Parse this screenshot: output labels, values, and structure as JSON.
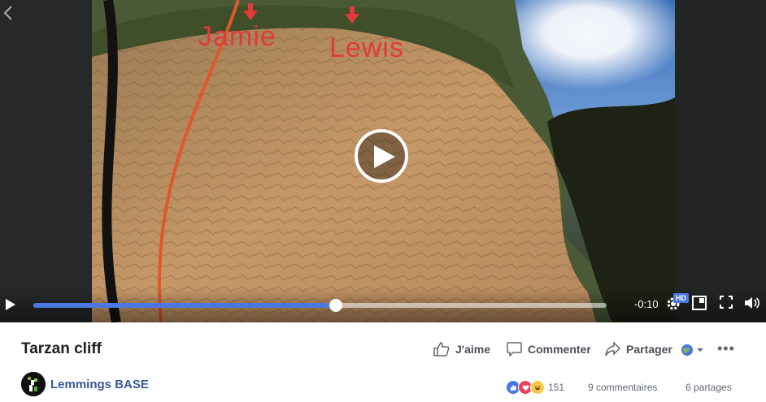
{
  "video": {
    "markers": [
      "Jamie",
      "Lewis"
    ],
    "time_remaining": "-0:10",
    "progress_fraction": 0.527,
    "quality_badge": "HD",
    "icons": [
      "play-icon",
      "gear-icon",
      "picture-in-picture-icon",
      "fullscreen-icon",
      "volume-icon",
      "chevron-left-icon"
    ]
  },
  "post": {
    "title": "Tarzan cliff",
    "page_name": "Lemmings BASE",
    "actions": {
      "like": "J'aime",
      "comment": "Commenter",
      "share": "Partager"
    },
    "reaction_count": "151",
    "comments_count": "9 commentaires",
    "shares_count": "6 partages",
    "more": "•••"
  },
  "colors": {
    "accent": "#4a78e0",
    "link": "#385898",
    "marker": "#e23a3a"
  }
}
